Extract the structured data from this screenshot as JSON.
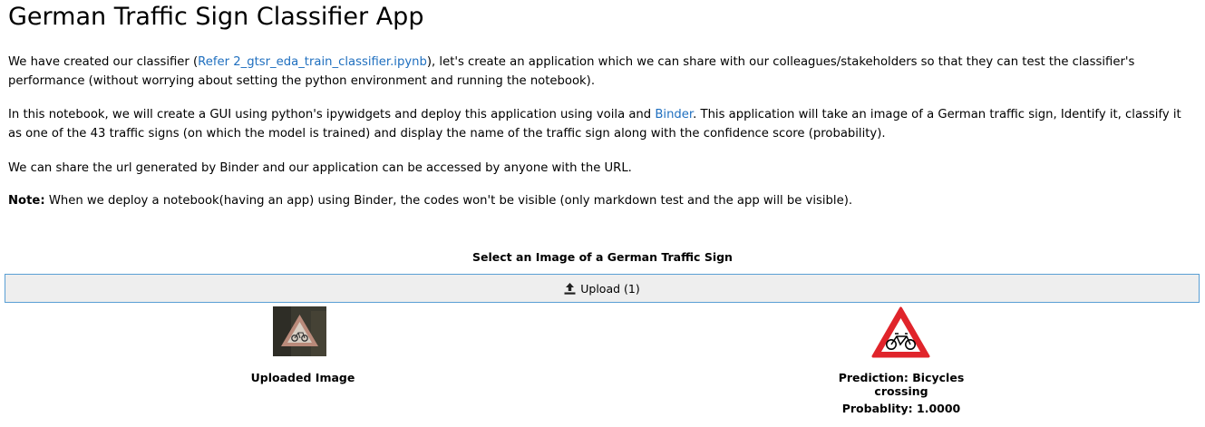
{
  "title": "German Traffic Sign Classifier App",
  "intro": {
    "p1_before": "We have created our classifier (",
    "p1_link": "Refer 2_gtsr_eda_train_classifier.ipynb",
    "p1_after": "), let's create an application which we can share with our colleagues/stakeholders so that they can test the classifier's performance (without worrying about setting the python environment and running the notebook).",
    "p2_before": "In this notebook, we will create a GUI using python's ipywidgets and deploy this application using voila and ",
    "p2_link": "Binder",
    "p2_after": ". This application will take an image of a German traffic sign, Identify it, classify it as one of the 43 traffic signs (on which the model is trained) and display the name of the traffic sign along with the confidence score (probability).",
    "p3": "We can share the url generated by Binder and our application can be accessed by anyone with the URL.",
    "p4_bold": "Note:",
    "p4_text": " When we deploy a notebook(having an app) using Binder, the codes won't be visible (only markdown test and the app will be visible)."
  },
  "app": {
    "select_label": "Select an Image of a German Traffic Sign",
    "upload_label": "Upload (1)",
    "upload_icon": "upload-icon",
    "uploaded_caption": "Uploaded Image",
    "prediction_caption": "Prediction: Bicycles crossing",
    "probability_caption": "Probablity: 1.0000"
  },
  "colors": {
    "link": "#1f6fbf",
    "button_border": "#5a9fd4",
    "button_bg": "#eeeeee",
    "sign_red": "#e0242b"
  }
}
